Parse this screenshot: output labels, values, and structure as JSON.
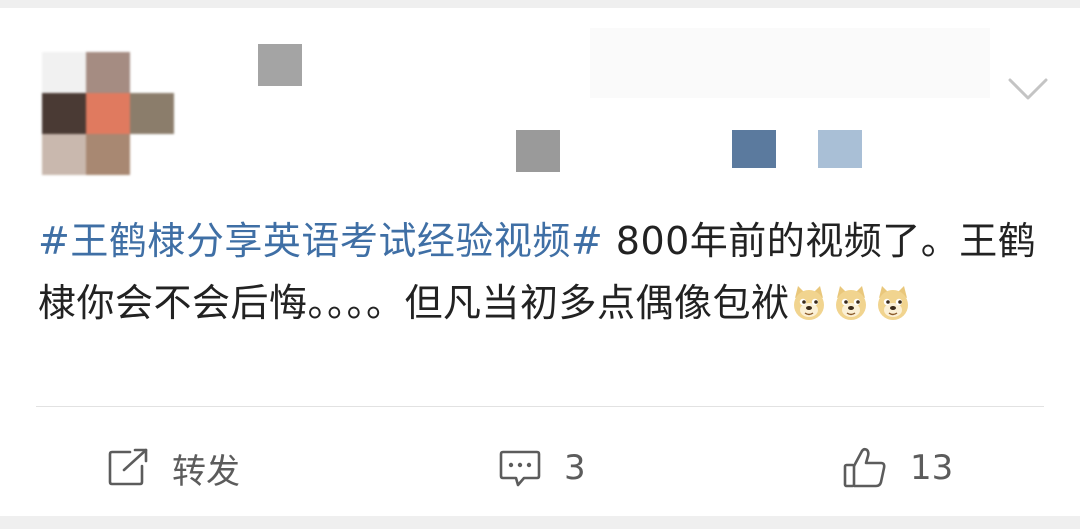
{
  "post": {
    "hashtag": "#王鹤棣分享英语考试经验视频#",
    "text": " 800年前的视频了。王鹤棣你会不会后悔。。。。但凡当初多点偶像包袱"
  },
  "emoji": {
    "name": "doge",
    "count": 3
  },
  "actions": {
    "repost_label": "转发",
    "comment_count": "3",
    "like_count": "13"
  },
  "icons": {
    "repost": "share-square-icon",
    "comment": "comment-bubble-icon",
    "like": "thumbs-up-icon",
    "menu": "chevron-down-icon"
  },
  "colors": {
    "hashtag": "#3f6fa5",
    "text": "#222222",
    "action": "#5c5c5c",
    "background": "#efefef"
  }
}
